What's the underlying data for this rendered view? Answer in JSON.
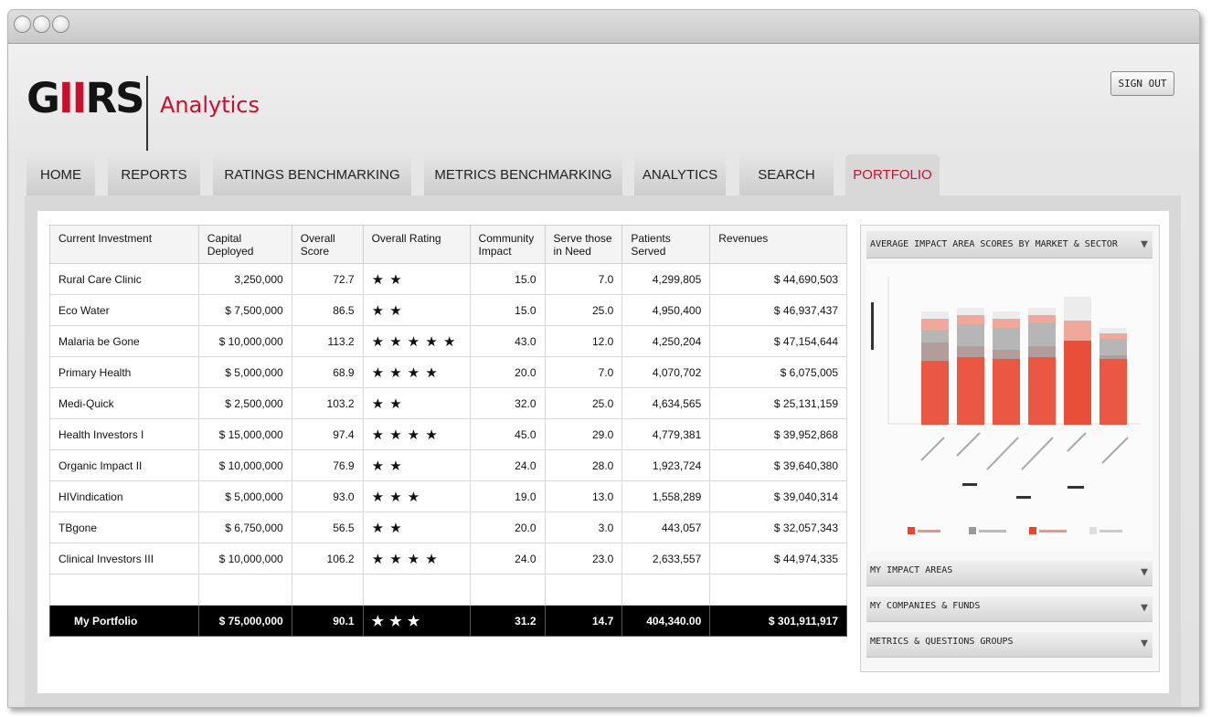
{
  "app": {
    "logo": {
      "brand_left": "G",
      "brand_red": "II",
      "brand_right": "RS",
      "subtitle": "Analytics"
    },
    "sign_out_label": "SIGN OUT"
  },
  "tabs": [
    "HOME",
    "REPORTS",
    "RATINGS BENCHMARKING",
    "METRICS BENCHMARKING",
    "ANALYTICS",
    "SEARCH",
    "PORTFOLIO"
  ],
  "active_tab": "PORTFOLIO",
  "table": {
    "headers": [
      "Current Investment",
      "Capital Deployed",
      "Overall Score",
      "Overall Rating",
      "Community Impact",
      "Serve those in Need",
      "Patients Served",
      "Revenues"
    ],
    "rows": [
      {
        "name": "Rural Care Clinic",
        "capital": "3,250,000",
        "score": "72.7",
        "rating": "★ ★",
        "stars": 2,
        "community": "15.0",
        "serve": "7.0",
        "patients": "4,299,805",
        "revenues": "$ 44,690,503"
      },
      {
        "name": "Eco Water",
        "capital": "$ 7,500,000",
        "score": "86.5",
        "rating": "★ ★",
        "stars": 2,
        "community": "15.0",
        "serve": "25.0",
        "patients": "4,950,400",
        "revenues": "$ 46,937,437"
      },
      {
        "name": "Malaria be Gone",
        "capital": "$ 10,000,000",
        "score": "113.2",
        "rating": "★ ★ ★ ★ ★",
        "stars": 5,
        "community": "43.0",
        "serve": "12.0",
        "patients": "4,250,204",
        "revenues": "$ 47,154,644"
      },
      {
        "name": "Primary Health",
        "capital": "$ 5,000,000",
        "score": "68.9",
        "rating": "★ ★ ★ ★",
        "stars": 4,
        "community": "20.0",
        "serve": "7.0",
        "patients": "4,070,702",
        "revenues": "$ 6,075,005"
      },
      {
        "name": "Medi-Quick",
        "capital": "$ 2,500,000",
        "score": "103.2",
        "rating": "★ ★",
        "stars": 2,
        "community": "32.0",
        "serve": "25.0",
        "patients": "4,634,565",
        "revenues": "$ 25,131,159"
      },
      {
        "name": "Health Investors I",
        "capital": "$ 15,000,000",
        "score": "97.4",
        "rating": "★ ★ ★ ★",
        "stars": 4,
        "community": "45.0",
        "serve": "29.0",
        "patients": "4,779,381",
        "revenues": "$ 39,952,868"
      },
      {
        "name": "Organic Impact II",
        "capital": "$ 10,000,000",
        "score": "76.9",
        "rating": "★ ★",
        "stars": 2,
        "community": "24.0",
        "serve": "28.0",
        "patients": "1,923,724",
        "revenues": "$ 39,640,380"
      },
      {
        "name": "HIVindication",
        "capital": "$ 5,000,000",
        "score": "93.0",
        "rating": "★ ★ ★",
        "stars": 3,
        "community": "19.0",
        "serve": "13.0",
        "patients": "1,558,289",
        "revenues": "$ 39,040,314"
      },
      {
        "name": "TBgone",
        "capital": "$ 6,750,000",
        "score": "56.5",
        "rating": "★ ★",
        "stars": 2,
        "community": "20.0",
        "serve": "3.0",
        "patients": "443,057",
        "revenues": "$ 32,057,343"
      },
      {
        "name": "Clinical Investors III",
        "capital": "$ 10,000,000",
        "score": "106.2",
        "rating": "★ ★ ★ ★",
        "stars": 4,
        "community": "24.0",
        "serve": "23.0",
        "patients": "2,633,557",
        "revenues": "$ 44,974,335"
      }
    ],
    "total": {
      "name": "My Portfolio",
      "capital": "$ 75,000,000",
      "score": "90.1",
      "rating": "★ ★ ★",
      "stars": 3,
      "community": "31.2",
      "serve": "14.7",
      "patients": "404,340.00",
      "revenues": "$ 301,911,917"
    }
  },
  "side_panel": {
    "chart_header": "AVERAGE IMPACT AREA SCORES BY MARKET & SECTOR",
    "accordions": [
      "MY IMPACT AREAS",
      "MY COMPANIES & FUNDS",
      "METRICS & QUESTIONS GROUPS"
    ],
    "colors": {
      "segment_1": "#e8452d",
      "segment_2": "#f0a89a",
      "segment_3": "#a9a9a9",
      "segment_4": "#ececec",
      "accent": "#c8102e"
    }
  }
}
